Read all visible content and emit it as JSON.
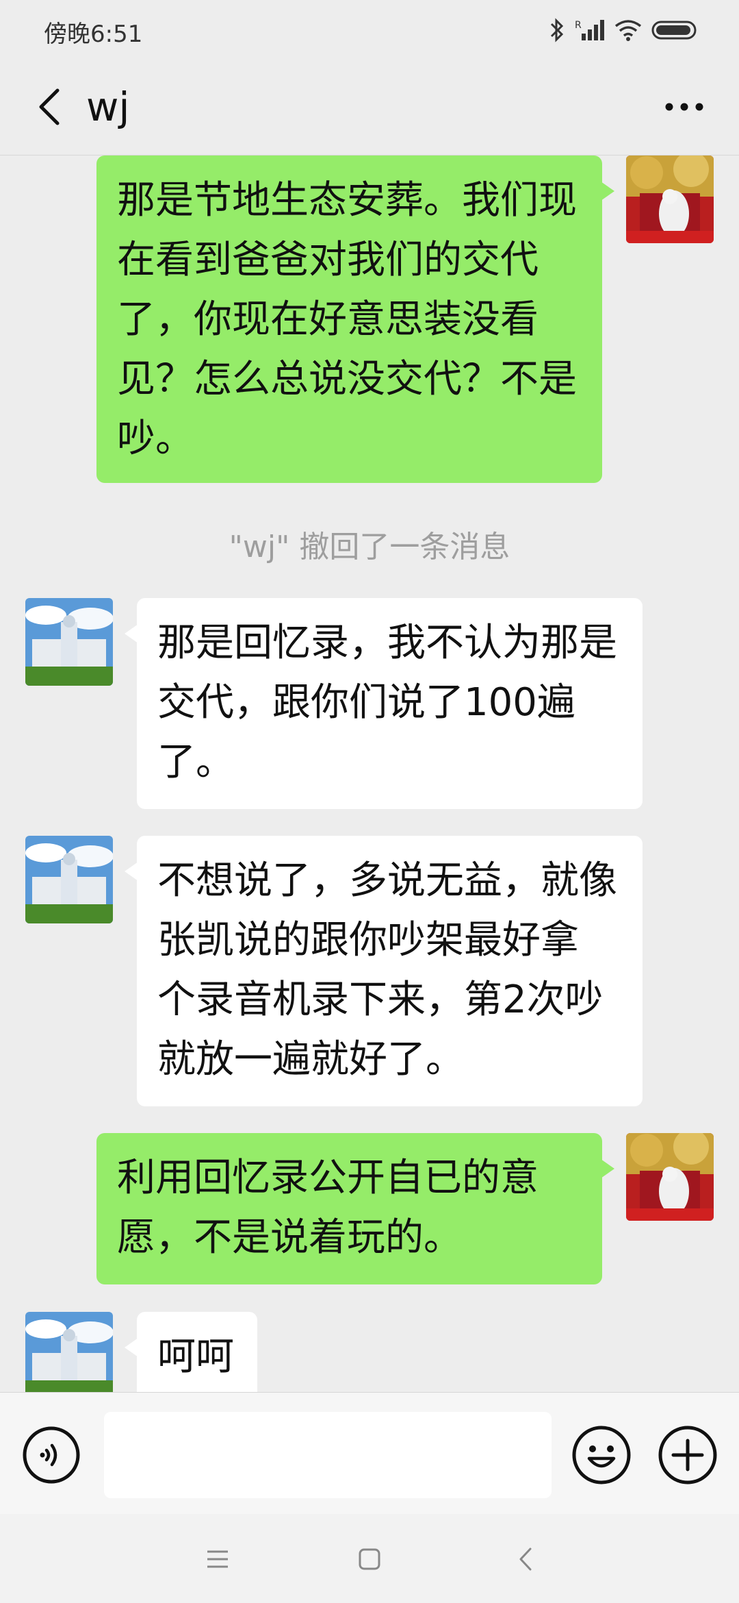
{
  "status_bar": {
    "time": "傍晚6:51"
  },
  "header": {
    "title": "wj"
  },
  "colors": {
    "sent_bubble": "#95ec69",
    "received_bubble": "#ffffff",
    "background": "#ededed"
  },
  "messages": [
    {
      "from": "me",
      "text": "那是节地生态安葬。我们现在看到爸爸对我们的交代了，你现在好意思装没看见？怎么总说没交代？不是吵。",
      "lines": [
        "那是节地生态安葬。我们现",
        "在看到爸爸对我们的交代",
        "了，你现在好意思装没看",
        "见？怎么总说没交代？不是",
        "吵。"
      ]
    },
    {
      "from": "system",
      "text": "\"wj\" 撤回了一条消息"
    },
    {
      "from": "wj",
      "text": "那是回忆录，我不认为那是交代，跟你们说了100遍了。",
      "lines": [
        "那是回忆录，我不认为那是",
        "交代，跟你们说了100遍",
        "了。"
      ]
    },
    {
      "from": "wj",
      "text": "不想说了，多说无益，就像张凯说的跟你吵架最好拿个录音机录下来，第2次吵就放一遍就好了。",
      "lines": [
        "不想说了，多说无益，就像",
        "张凯说的跟你吵架最好拿",
        "个录音机录下来，第2次吵",
        "就放一遍就好了。"
      ]
    },
    {
      "from": "me",
      "text": "利用回忆录公开自已的意愿，不是说着玩的。",
      "lines": [
        "利用回忆录公开自已的意",
        "愿，不是说着玩的。"
      ]
    },
    {
      "from": "wj",
      "text": "呵呵",
      "lines": [
        "呵呵"
      ]
    }
  ],
  "input_bar": {
    "voice_icon": "voice-icon",
    "emoji_icon": "emoji-icon",
    "plus_icon": "plus-icon"
  },
  "nav_bar": {
    "icons": [
      "menu-icon",
      "home-icon",
      "back-icon"
    ]
  }
}
